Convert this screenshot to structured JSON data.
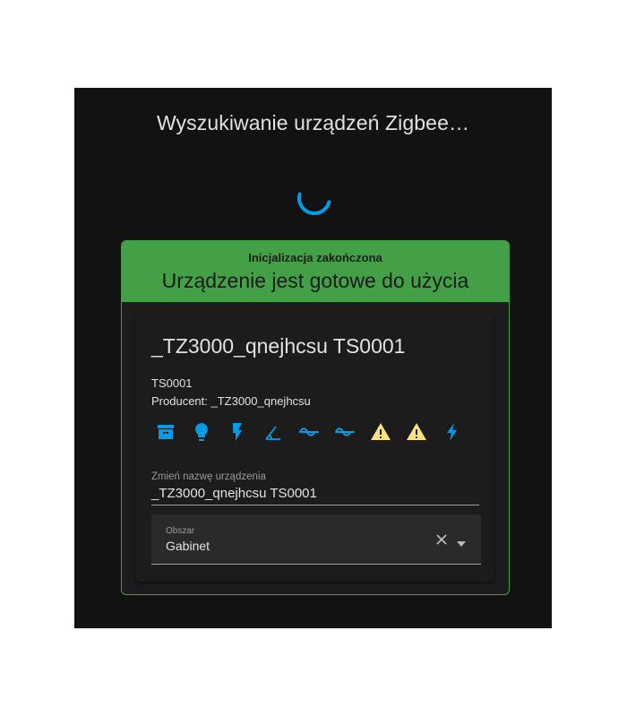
{
  "dialog": {
    "title": "Wyszukiwanie urządzeń Zigbee…"
  },
  "status": {
    "subtitle": "Inicjalizacja zakończona",
    "title": "Urządzenie jest gotowe do użycia"
  },
  "device": {
    "name": "_TZ3000_qnejhcsu TS0001",
    "model": "TS0001",
    "manufacturer": "Producent: _TZ3000_qnejhcsu",
    "entity_icons": [
      "archive-icon",
      "lightbulb-icon",
      "flash-icon",
      "angle-icon",
      "sine-wave-icon",
      "sine-wave-icon",
      "warning-icon",
      "warning-icon",
      "lightning-icon"
    ]
  },
  "rename": {
    "label": "Zmień nazwę urządzenia",
    "value": "_TZ3000_qnejhcsu TS0001"
  },
  "area": {
    "label": "Obszar",
    "value": "Gabinet"
  },
  "colors": {
    "background": "#121212",
    "accent_green": "#43a047",
    "icon_blue": "#039be5",
    "warning_yellow": "#ffe082",
    "spinner_blue": "#039be5"
  }
}
